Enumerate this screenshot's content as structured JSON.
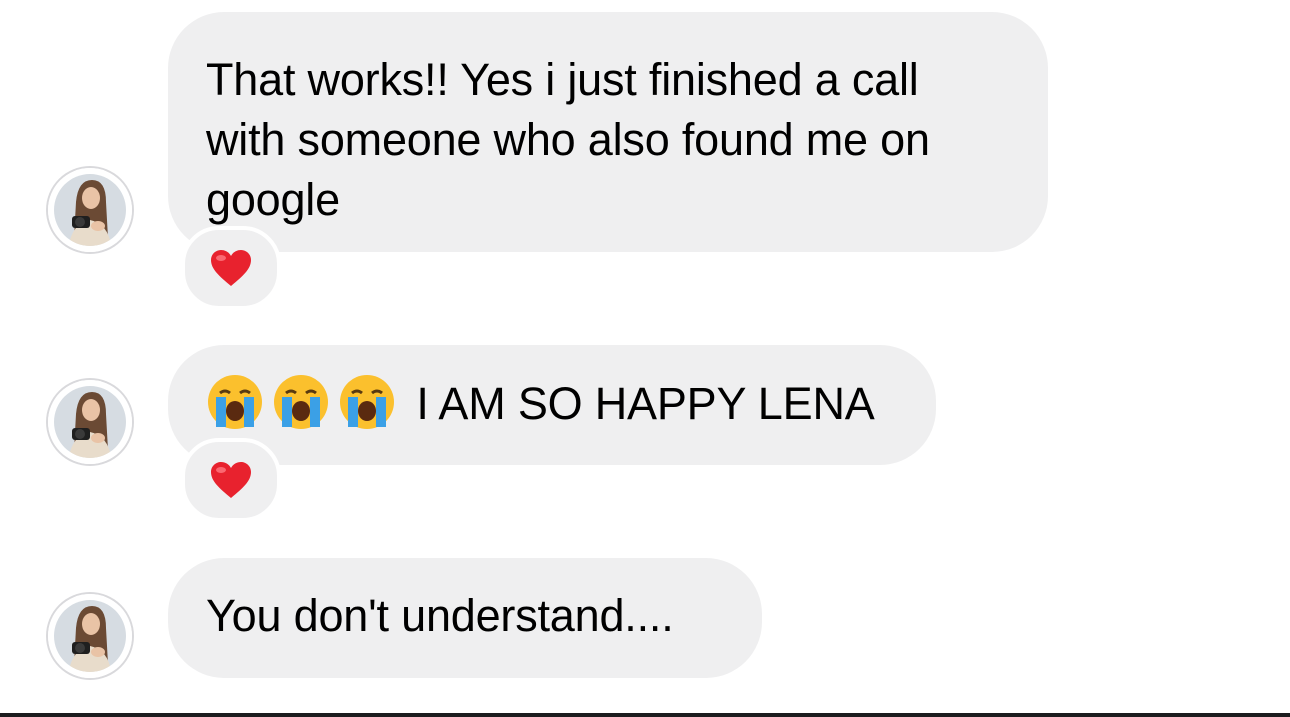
{
  "conversation": {
    "messages": [
      {
        "sender": "contact",
        "avatar_icon": "profile-photo-woman-with-camera",
        "text": "That works!! Yes i just finished a call with someone who also found me on google",
        "reaction": "❤️"
      },
      {
        "sender": "contact",
        "avatar_icon": "profile-photo-woman-with-camera",
        "emoji_prefix": [
          "loudly-crying-face",
          "loudly-crying-face",
          "loudly-crying-face"
        ],
        "text": "I AM SO HAPPY LENA",
        "reaction": "❤️"
      },
      {
        "sender": "contact",
        "avatar_icon": "profile-photo-woman-with-camera",
        "text": "You don't understand...."
      }
    ]
  },
  "colors": {
    "bubble_background": "#efeff0",
    "reaction_heart": "#e8222e",
    "emoji_face": "#fbc02d",
    "emoji_tears": "#3ba0e6"
  }
}
